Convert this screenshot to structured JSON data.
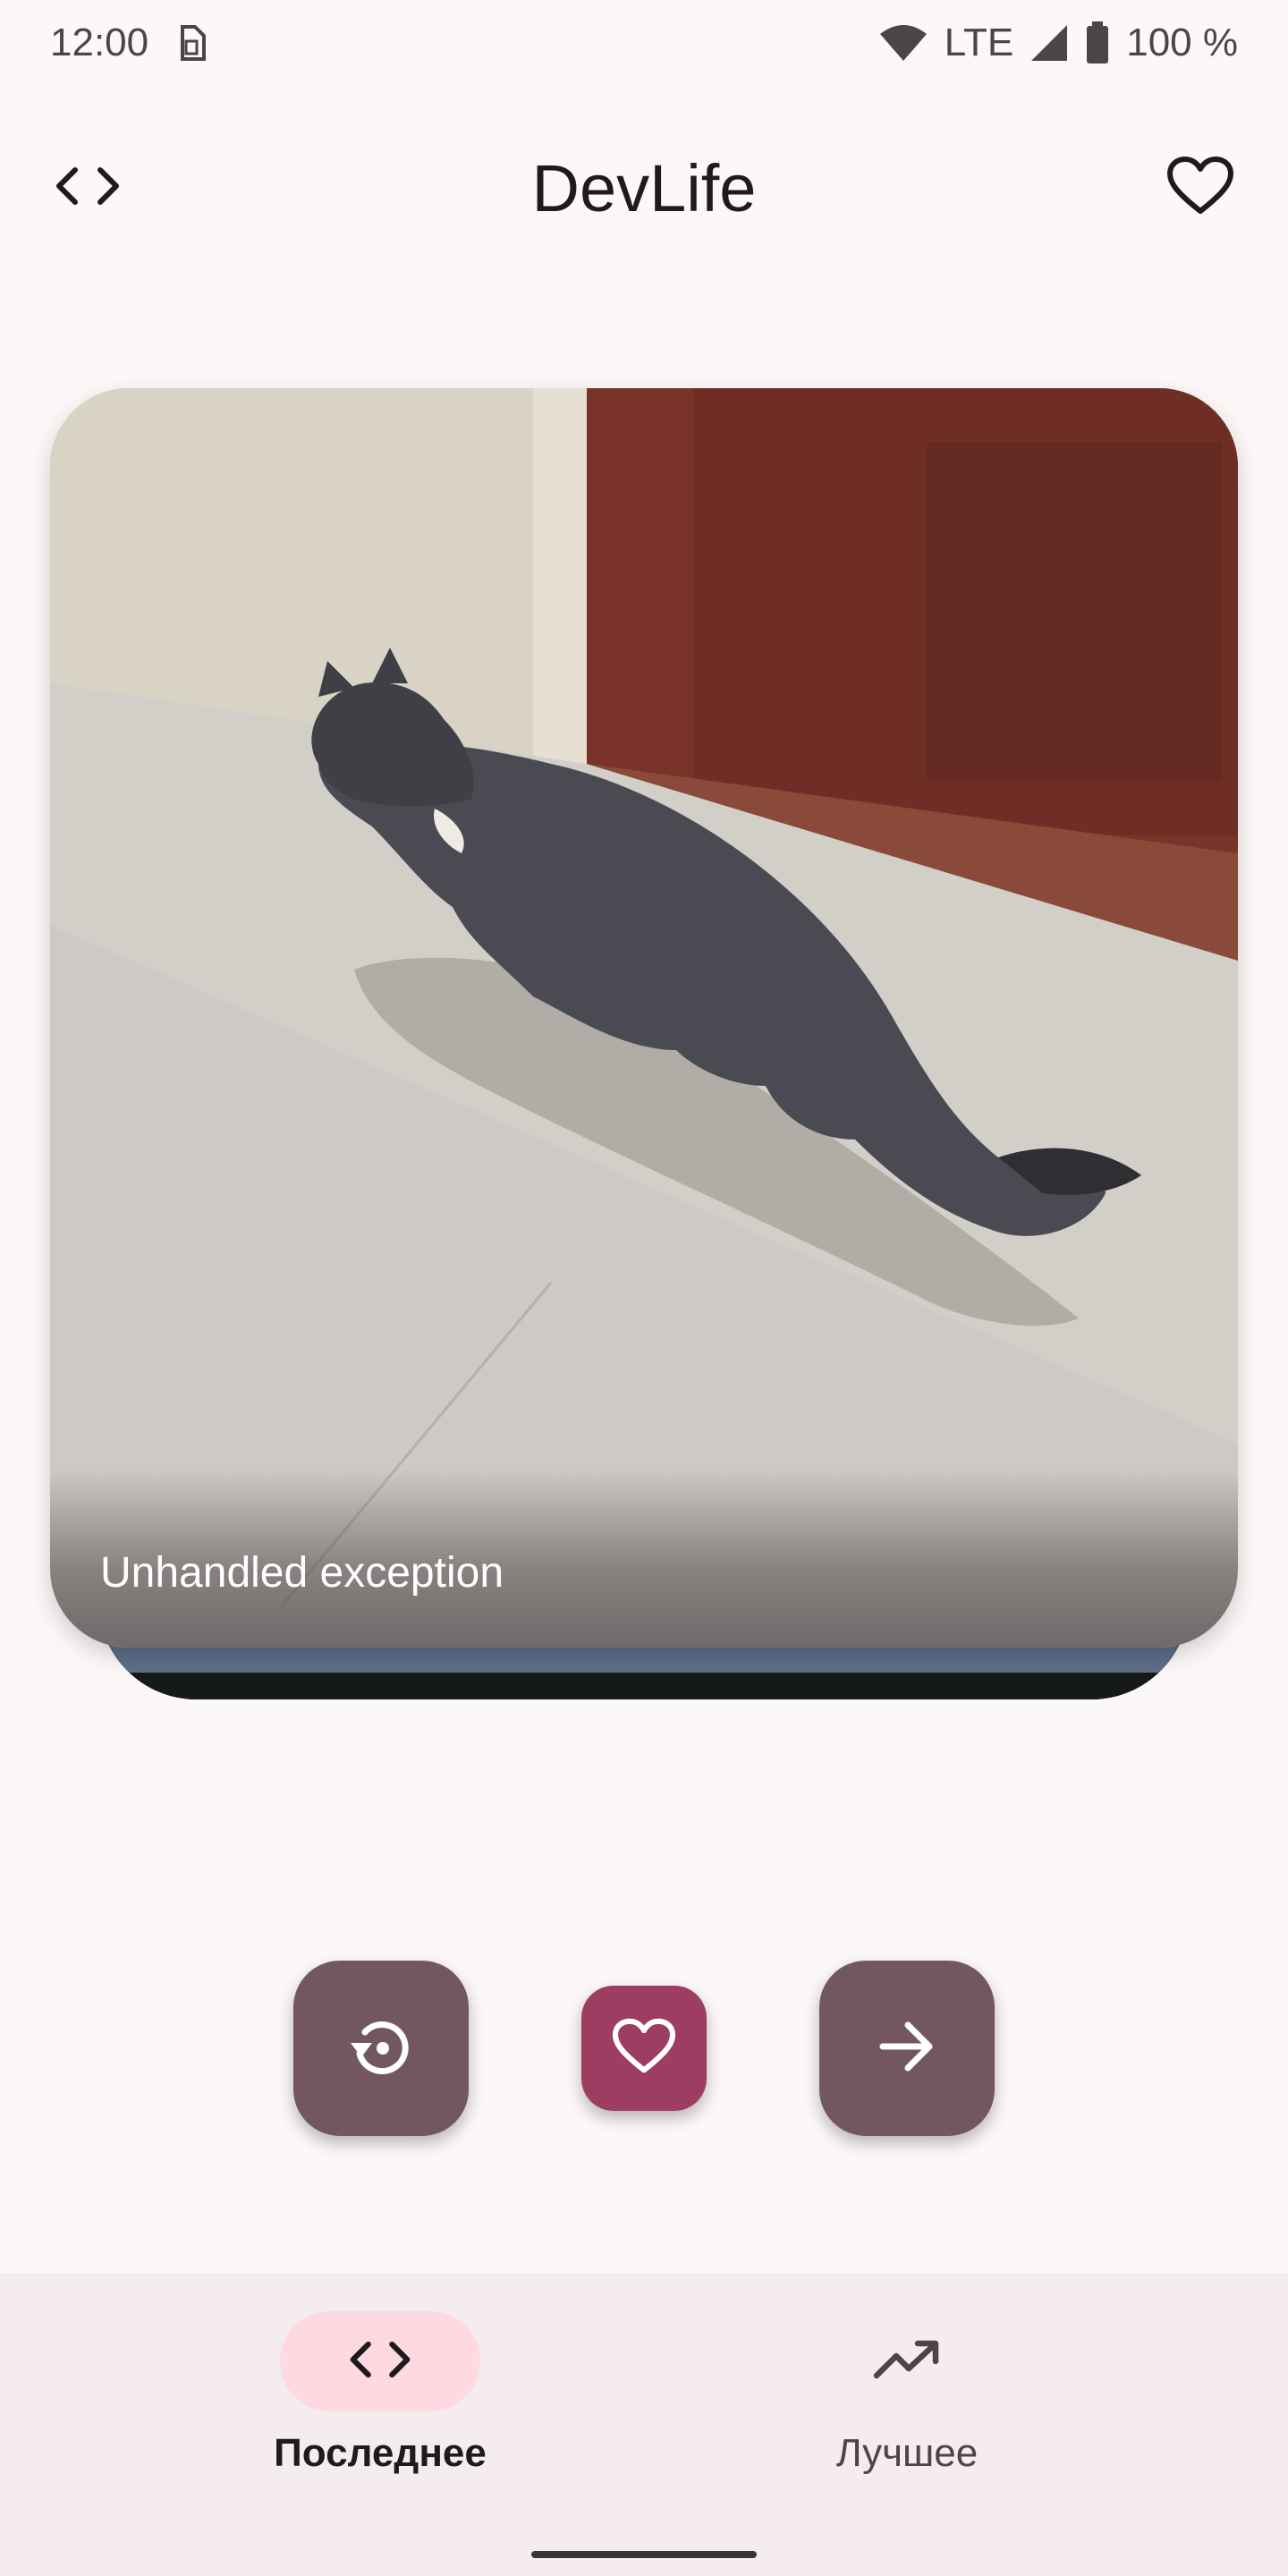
{
  "status_bar": {
    "time": "12:00",
    "network": "LTE",
    "battery": "100 %",
    "icons": [
      "sim-card-icon",
      "wifi-icon",
      "signal-icon",
      "battery-icon"
    ]
  },
  "app_bar": {
    "title": "DevLife",
    "left_icon": "code-icon",
    "right_icon": "heart-outline-icon"
  },
  "post": {
    "caption": "Unhandled exception"
  },
  "actions": {
    "replay_icon": "replay-icon",
    "like_icon": "heart-outline-icon",
    "next_icon": "arrow-right-icon"
  },
  "bottom_nav": {
    "items": [
      {
        "label": "Последнее",
        "icon": "code-icon",
        "selected": true
      },
      {
        "label": "Лучшее",
        "icon": "trending-up-icon",
        "selected": false
      }
    ]
  },
  "colors": {
    "background": "#fdf8f8",
    "fab_primary": "#735760",
    "fab_accent": "#9c3d61",
    "nav_background": "#f4ecee",
    "nav_indicator": "#ffd9e1"
  }
}
